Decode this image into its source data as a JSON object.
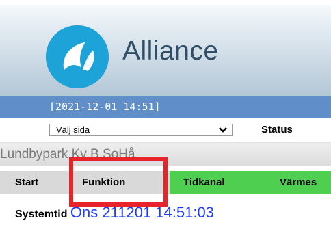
{
  "header": {
    "brand_name": "Alliance",
    "logo_icon": "alliance-logo-icon",
    "colors": {
      "logo_blue": "#1ea3d8",
      "brand_text": "#2f4f66",
      "date_bar": "#5f8ec8"
    }
  },
  "datebar": {
    "timestamp": "[2021-12-01 14:51]"
  },
  "toolbar": {
    "page_select_value": "Välj sida",
    "status_label": "Status",
    "chevron_icon": "chevron-down-icon"
  },
  "site": {
    "name": "Lundbypark Kv B SoHå"
  },
  "tabs": {
    "items": [
      {
        "label": "Start",
        "color": "#d9d9d9"
      },
      {
        "label": "Funktion",
        "color": "#d9d9d9",
        "highlighted": true
      },
      {
        "label": "Tidkanal",
        "color": "#4fcf4f"
      },
      {
        "label": "Värmes",
        "color": "#4fcf4f"
      }
    ]
  },
  "system": {
    "label": "Systemtid",
    "value": "Ons 211201 14:51:03",
    "value_color": "#1e3cff"
  },
  "annotation": {
    "highlight_color": "#e8232a"
  }
}
